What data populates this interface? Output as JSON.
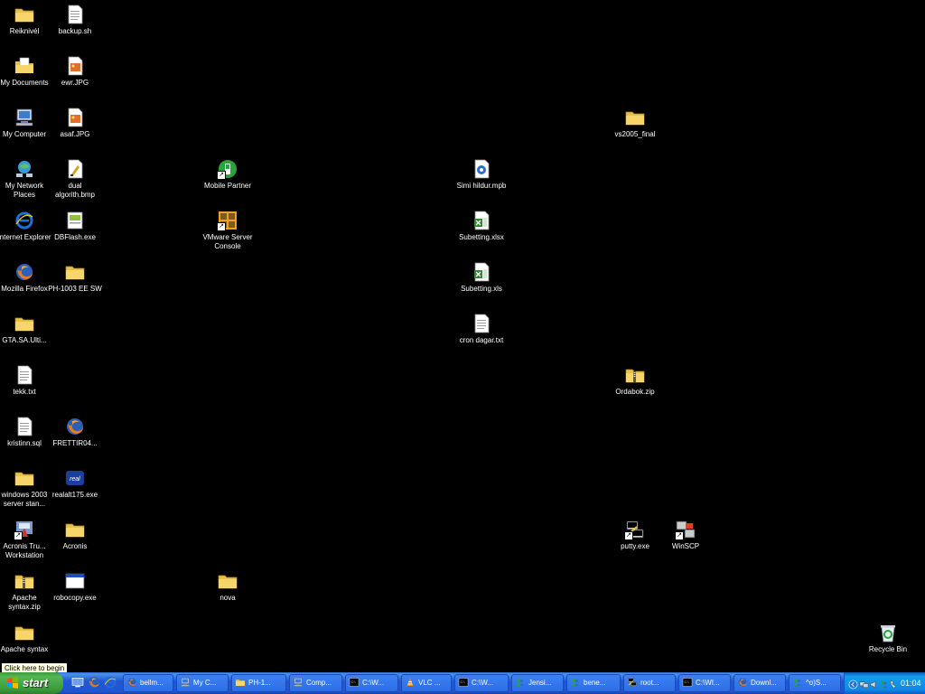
{
  "desktop_icons": [
    {
      "label": "Reiknivél",
      "icon": "folder-icon"
    },
    {
      "label": "backup.sh",
      "icon": "script-file-icon"
    },
    {
      "label": "My Documents",
      "icon": "my-documents-icon"
    },
    {
      "label": "ewr.JPG",
      "icon": "jpg-file-icon"
    },
    {
      "label": "My Computer",
      "icon": "my-computer-icon"
    },
    {
      "label": "asaf.JPG",
      "icon": "jpg-file-icon"
    },
    {
      "label": "vs2005_final",
      "icon": "folder-icon"
    },
    {
      "label": "My Network Places",
      "icon": "network-places-icon"
    },
    {
      "label": "dual algorith.bmp",
      "icon": "bmp-file-icon"
    },
    {
      "label": "Mobile Partner",
      "icon": "mobile-partner-icon"
    },
    {
      "label": "Simi hildur.mpb",
      "icon": "mpb-file-icon"
    },
    {
      "label": "Internet Explorer",
      "icon": "internet-explorer-icon"
    },
    {
      "label": "DBFlash.exe",
      "icon": "exe-file-icon"
    },
    {
      "label": "VMware Server Console",
      "icon": "vmware-icon"
    },
    {
      "label": "Subetting.xlsx",
      "icon": "excel-file-icon"
    },
    {
      "label": "Mozilla Firefox",
      "icon": "firefox-icon"
    },
    {
      "label": "PH-1003 EE SW",
      "icon": "folder-icon"
    },
    {
      "label": "Subetting.xls",
      "icon": "excel-file-icon"
    },
    {
      "label": "GTA.SA.Ulti...",
      "icon": "folder-icon"
    },
    {
      "label": "cron dagar.txt",
      "icon": "text-file-icon"
    },
    {
      "label": "Ordabok.zip",
      "icon": "zip-folder-icon"
    },
    {
      "label": "tekk.txt",
      "icon": "text-file-icon"
    },
    {
      "label": "kristinn.sql",
      "icon": "text-file-icon"
    },
    {
      "label": "FRETTIR04...",
      "icon": "firefox-file-icon"
    },
    {
      "label": "windows 2003 server stan...",
      "icon": "folder-icon"
    },
    {
      "label": "realalt175.exe",
      "icon": "real-player-icon"
    },
    {
      "label": "Acronis Tru... Workstation",
      "icon": "acronis-icon"
    },
    {
      "label": "Acronis",
      "icon": "folder-icon"
    },
    {
      "label": "putty.exe",
      "icon": "putty-icon"
    },
    {
      "label": "WinSCP",
      "icon": "winscp-icon"
    },
    {
      "label": "Apache syntax.zip",
      "icon": "zip-folder-icon"
    },
    {
      "label": "robocopy.exe",
      "icon": "exe-window-icon"
    },
    {
      "label": "nova",
      "icon": "folder-icon"
    },
    {
      "label": "Apache syntax",
      "icon": "folder-icon"
    },
    {
      "label": "Recycle Bin",
      "icon": "recycle-bin-icon"
    }
  ],
  "tooltip": "Click here to begin",
  "start_button": {
    "label": "start"
  },
  "quick_launch": [
    {
      "icon": "show-desktop-icon"
    },
    {
      "icon": "firefox-icon"
    },
    {
      "icon": "internet-explorer-icon"
    }
  ],
  "taskbar_buttons": [
    {
      "label": "bellm...",
      "icon": "firefox-icon"
    },
    {
      "label": "My C...",
      "icon": "my-computer-icon"
    },
    {
      "label": "PH-1...",
      "icon": "folder-icon"
    },
    {
      "label": "Comp...",
      "icon": "computer-management-icon"
    },
    {
      "label": "C:\\W...",
      "icon": "cmd-icon"
    },
    {
      "label": "VLC ...",
      "icon": "vlc-icon"
    },
    {
      "label": "C:\\W...",
      "icon": "cmd-icon"
    },
    {
      "label": "Jensi...",
      "icon": "msn-icon"
    },
    {
      "label": "bene...",
      "icon": "msn-icon"
    },
    {
      "label": "root...",
      "icon": "putty-icon"
    },
    {
      "label": "C:\\WI...",
      "icon": "cmd-icon"
    },
    {
      "label": "Downl...",
      "icon": "firefox-icon"
    },
    {
      "label": "^o)S...",
      "icon": "msn-icon"
    }
  ],
  "system_tray": {
    "icons": [
      {
        "icon": "expand-tray-icon"
      },
      {
        "icon": "network-tray-icon"
      },
      {
        "icon": "speaker-icon"
      },
      {
        "icon": "msn-tray-icon"
      },
      {
        "icon": "phone-tray-icon"
      }
    ],
    "clock": "01:04"
  }
}
